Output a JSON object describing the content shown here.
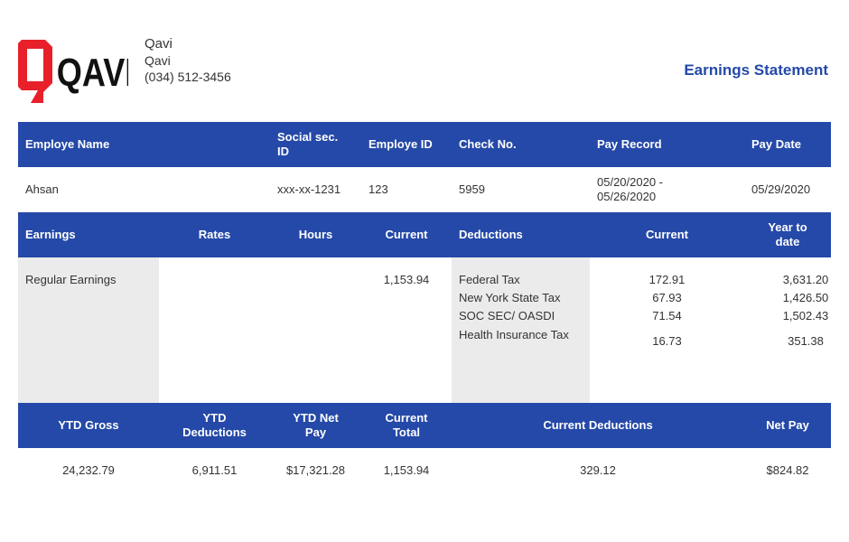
{
  "company": {
    "name": "Qavi",
    "line2": "Qavi",
    "phone": "(034) 512-3456",
    "logo_text": "QAVI"
  },
  "doc_title": "Earnings Statement",
  "employee_headers": [
    "Employe Name",
    "Social sec. ID",
    "Employe ID",
    "Check No.",
    "Pay Record",
    "Pay Date"
  ],
  "employee_values": [
    "Ahsan",
    "xxx-xx-1231",
    "123",
    "5959",
    "05/20/2020 - 05/26/2020",
    "05/29/2020"
  ],
  "earnings_headers": [
    "Earnings",
    "Rates",
    "Hours",
    "Current",
    "Deductions",
    "Current",
    "Year to date"
  ],
  "earnings": {
    "name": "Regular Earnings",
    "rate": "",
    "hours": "",
    "current": "1,153.94"
  },
  "deductions": [
    {
      "name": "Federal Tax",
      "current": "172.91",
      "ytd": "3,631.20"
    },
    {
      "name": "New York State Tax",
      "current": "67.93",
      "ytd": "1,426.50"
    },
    {
      "name": "SOC SEC/ OASDI",
      "current": "71.54",
      "ytd": "1,502.43"
    },
    {
      "name": "Health Insurance Tax",
      "current": "16.73",
      "ytd": "351.38"
    }
  ],
  "summary_headers": [
    "YTD Gross",
    "YTD Deductions",
    "YTD Net Pay",
    "Current Total",
    "Current Deductions",
    "Net Pay"
  ],
  "summary_values": [
    "24,232.79",
    "6,911.51",
    "$17,321.28",
    "1,153.94",
    "329.12",
    "$824.82"
  ],
  "colors": {
    "accent": "#2549a8",
    "logo_red": "#e8202a",
    "shade": "#ebebeb"
  }
}
